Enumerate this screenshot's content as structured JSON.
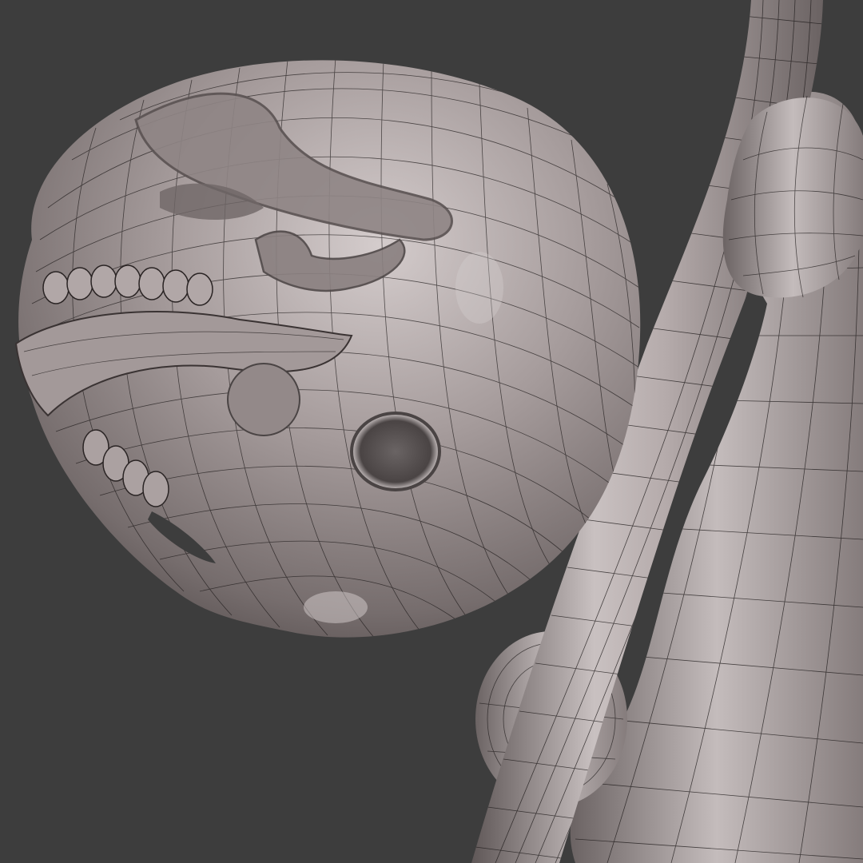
{
  "viewport": {
    "background_color": "#3d3d3d",
    "content": "skull-and-bones-wireframe-render"
  },
  "material": {
    "base_color": "#9d9393",
    "highlight_color": "#d6cece",
    "shadow_color": "#5d5656",
    "wire_color": "#1e1a1a"
  }
}
